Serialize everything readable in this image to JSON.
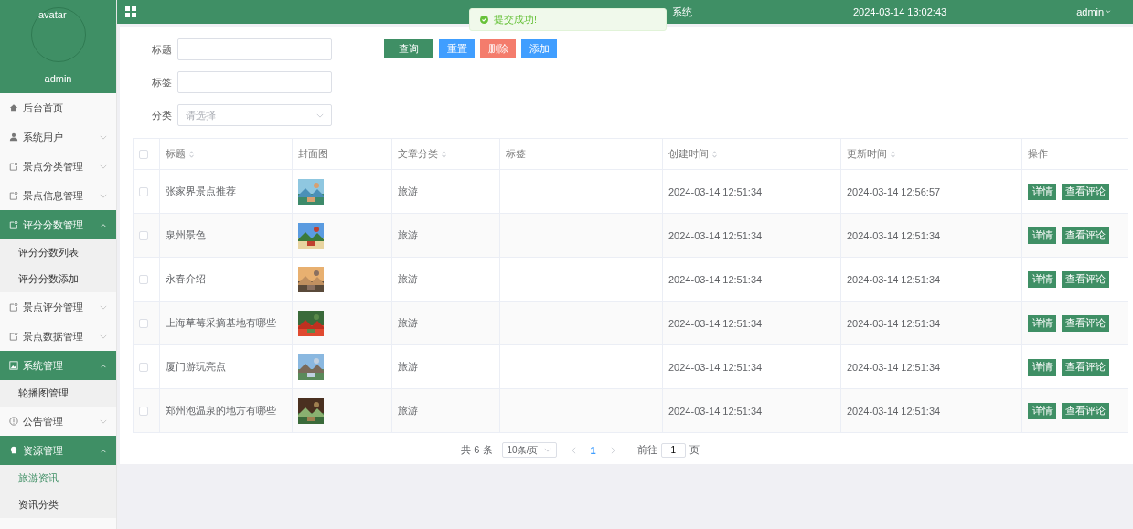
{
  "sidebar": {
    "avatar_label": "avatar",
    "username": "admin",
    "menu": [
      {
        "label": "后台首页",
        "expandable": false,
        "expanded": false
      },
      {
        "label": "系统用户",
        "expandable": true,
        "expanded": false
      },
      {
        "label": "景点分类管理",
        "expandable": true,
        "expanded": false
      },
      {
        "label": "景点信息管理",
        "expandable": true,
        "expanded": false
      },
      {
        "label": "评分分数管理",
        "expandable": true,
        "expanded": true,
        "children": [
          {
            "label": "评分分数列表",
            "selected": false
          },
          {
            "label": "评分分数添加",
            "selected": false
          }
        ]
      },
      {
        "label": "景点评分管理",
        "expandable": true,
        "expanded": false
      },
      {
        "label": "景点数据管理",
        "expandable": true,
        "expanded": false
      },
      {
        "label": "系统管理",
        "expandable": true,
        "expanded": true,
        "children": [
          {
            "label": "轮播图管理",
            "selected": false
          }
        ]
      },
      {
        "label": "公告管理",
        "expandable": true,
        "expanded": false
      },
      {
        "label": "资源管理",
        "expandable": true,
        "expanded": true,
        "children": [
          {
            "label": "旅游资讯",
            "selected": true
          },
          {
            "label": "资讯分类",
            "selected": false
          }
        ]
      }
    ]
  },
  "header": {
    "title": "系统",
    "datetime": "2024-03-14 13:02:43",
    "user": "admin"
  },
  "toast": {
    "message": "提交成功!"
  },
  "search_form": {
    "fields": [
      {
        "label": "标题",
        "kind": "input"
      },
      {
        "label": "标签",
        "kind": "input"
      },
      {
        "label": "分类",
        "kind": "select",
        "placeholder": "请选择"
      }
    ],
    "buttons": [
      {
        "label": "查询",
        "color": "#3f8f65"
      },
      {
        "label": "重置",
        "color": "#409eff"
      },
      {
        "label": "删除",
        "color": "#f47c6c"
      },
      {
        "label": "添加",
        "color": "#409eff"
      }
    ]
  },
  "table": {
    "select_all_checked": false,
    "columns": [
      {
        "label": "标题",
        "sortable": true
      },
      {
        "label": "封面图",
        "sortable": false
      },
      {
        "label": "文章分类",
        "sortable": true
      },
      {
        "label": "标签",
        "sortable": false
      },
      {
        "label": "创建时间",
        "sortable": true
      },
      {
        "label": "更新时间",
        "sortable": true
      },
      {
        "label": "操作",
        "sortable": false
      }
    ],
    "rows": [
      {
        "checked": false,
        "title": "张家界景点推荐",
        "cover": {
          "kind": "picture"
        },
        "category": "旅游",
        "created": "2024-03-14 12:51:34",
        "updated": "2024-03-14 12:56:57",
        "actions": [
          "详情",
          "查看评论"
        ]
      },
      {
        "checked": false,
        "title": "泉州景色",
        "cover": {
          "kind": "picture"
        },
        "category": "旅游",
        "created": "2024-03-14 12:51:34",
        "updated": "2024-03-14 12:51:34",
        "actions": [
          "详情",
          "查看评论"
        ]
      },
      {
        "checked": false,
        "title": "永春介绍",
        "cover": {
          "kind": "picture"
        },
        "category": "旅游",
        "created": "2024-03-14 12:51:34",
        "updated": "2024-03-14 12:51:34",
        "actions": [
          "详情",
          "查看评论"
        ]
      },
      {
        "checked": false,
        "title": "上海草莓采摘基地有哪些",
        "cover": {
          "kind": "picture"
        },
        "category": "旅游",
        "created": "2024-03-14 12:51:34",
        "updated": "2024-03-14 12:51:34",
        "actions": [
          "详情",
          "查看评论"
        ]
      },
      {
        "checked": false,
        "title": "厦门游玩亮点",
        "cover": {
          "kind": "picture"
        },
        "category": "旅游",
        "created": "2024-03-14 12:51:34",
        "updated": "2024-03-14 12:51:34",
        "actions": [
          "详情",
          "查看评论"
        ]
      },
      {
        "checked": false,
        "title": "郑州泡温泉的地方有哪些",
        "cover": {
          "kind": "picture"
        },
        "category": "旅游",
        "created": "2024-03-14 12:51:34",
        "updated": "2024-03-14 12:51:34",
        "actions": [
          "详情",
          "查看评论"
        ]
      }
    ]
  },
  "pagination": {
    "total": "共 6 条",
    "page_size": "10条/页",
    "pages": [
      {
        "label": "1",
        "selected": true
      }
    ],
    "goto_label": "前往",
    "goto_value": "1",
    "goto_suffix": "页"
  }
}
